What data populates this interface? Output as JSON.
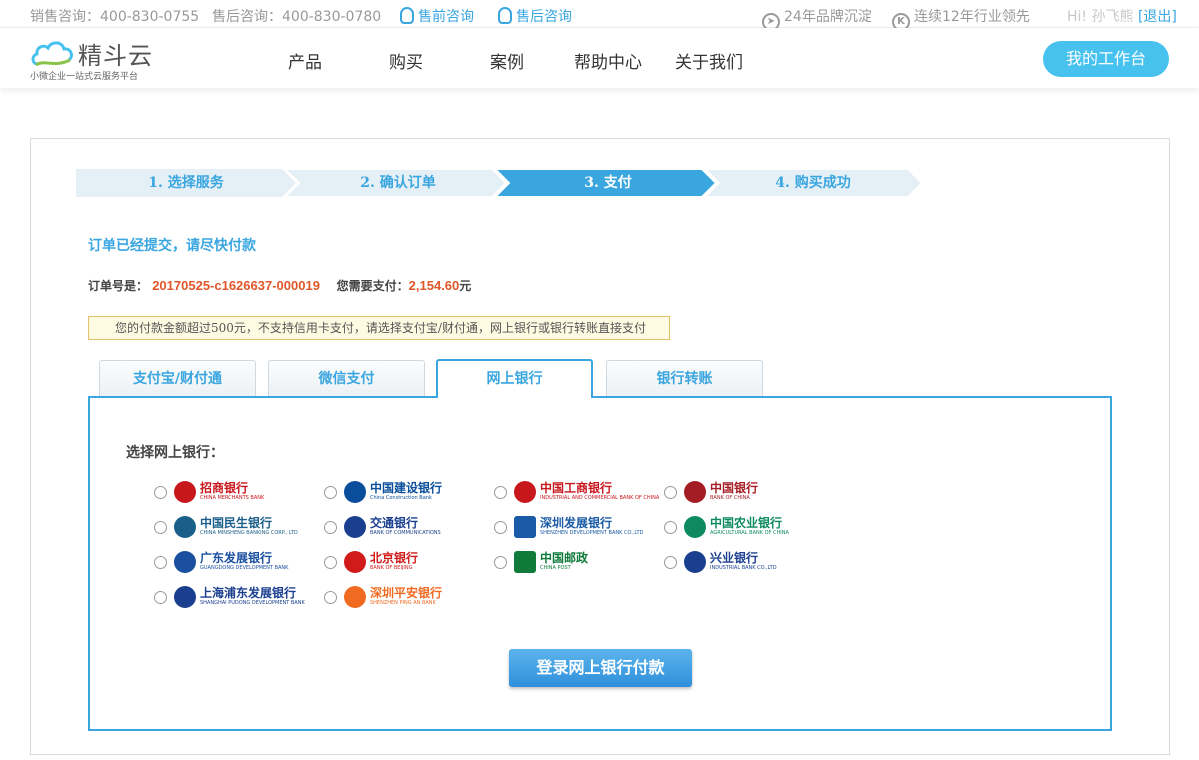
{
  "topbar": {
    "sales_label": "销售咨询：",
    "sales_phone": "400-830-0755",
    "aftersales_label": "售后咨询：",
    "aftersales_phone": "400-830-0780",
    "presale_link": "售前咨询",
    "aftersale_link": "售后咨询",
    "brand_years": "24年品牌沉淀",
    "industry_lead": "连续12年行业领先",
    "greeting": "Hi! 孙飞熊",
    "logout": "[退出]"
  },
  "header": {
    "logo_name": "精斗云",
    "logo_sub": "小微企业一站式云服务平台",
    "nav": [
      "产品",
      "购买",
      "案例",
      "帮助中心",
      "关于我们"
    ],
    "workspace_button": "我的工作台"
  },
  "steps": [
    "1. 选择服务",
    "2. 确认订单",
    "3. 支付",
    "4. 购买成功"
  ],
  "active_step": 2,
  "order": {
    "notice": "订单已经提交，请尽快付款",
    "order_no_label": "订单号是：",
    "order_no": "20170525-c1626637-000019",
    "amount_label": "您需要支付：",
    "amount": "2,154.60",
    "currency": "元",
    "warning": "您的付款金额超过500元，不支持信用卡支付，请选择支付宝/财付通，网上银行或银行转账直接支付"
  },
  "tabs": [
    "支付宝/财付通",
    "微信支付",
    "网上银行",
    "银行转账"
  ],
  "active_tab": 2,
  "bank_section": {
    "label": "选择网上银行：",
    "banks": [
      {
        "cn": "招商银行",
        "en": "CHINA MERCHANTS BANK",
        "color": "#c8161d",
        "icon": "cmb-logo-icon"
      },
      {
        "cn": "中国建设银行",
        "en": "China Construction Bank",
        "color": "#0a4e9b",
        "icon": "ccb-logo-icon"
      },
      {
        "cn": "中国工商银行",
        "en": "INDUSTRIAL AND COMMERCIAL BANK OF CHINA",
        "color": "#c8161d",
        "icon": "icbc-logo-icon"
      },
      {
        "cn": "中国银行",
        "en": "BANK OF CHINA",
        "color": "#a51d24",
        "icon": "boc-logo-icon"
      },
      {
        "cn": "中国民生银行",
        "en": "CHINA MINSHENG BANKING CORP., LTD",
        "color": "#1a5e8a",
        "icon": "cmbc-logo-icon"
      },
      {
        "cn": "交通银行",
        "en": "BANK OF COMMUNICATIONS",
        "color": "#1b3f8f",
        "icon": "bocom-logo-icon"
      },
      {
        "cn": "深圳发展银行",
        "en": "SHENZHEN DEVELOPMENT BANK CO.,LTD",
        "color": "#1b5aa6",
        "icon": "sdb-logo-icon"
      },
      {
        "cn": "中国农业银行",
        "en": "AGRICULTURAL BANK OF CHINA",
        "color": "#0d8a5f",
        "icon": "abc-logo-icon"
      },
      {
        "cn": "广东发展银行",
        "en": "GUANGDONG DEVELOPMENT BANK",
        "color": "#1b4fa0",
        "icon": "gdb-logo-icon"
      },
      {
        "cn": "北京银行",
        "en": "BANK OF BEIJING",
        "color": "#d11a1a",
        "icon": "bob-logo-icon"
      },
      {
        "cn": "中国邮政",
        "en": "CHINA POST",
        "color": "#0f7a3a",
        "icon": "post-logo-icon"
      },
      {
        "cn": "兴业银行",
        "en": "INDUSTRIAL BANK CO.,LTD",
        "color": "#1b3f8f",
        "icon": "cib-logo-icon"
      },
      {
        "cn": "上海浦东发展银行",
        "en": "SHANGHAI PUDONG DEVELOPMENT BANK",
        "color": "#1b3f8f",
        "icon": "spdb-logo-icon"
      },
      {
        "cn": "深圳平安银行",
        "en": "SHENZHEN PING AN BANK",
        "color": "#f06a22",
        "icon": "pingan-logo-icon"
      }
    ],
    "submit_button": "登录网上银行付款"
  },
  "colors": {
    "accent": "#3aa6e0",
    "amount": "#e1562a",
    "workspace_button": "#47c2ef"
  }
}
